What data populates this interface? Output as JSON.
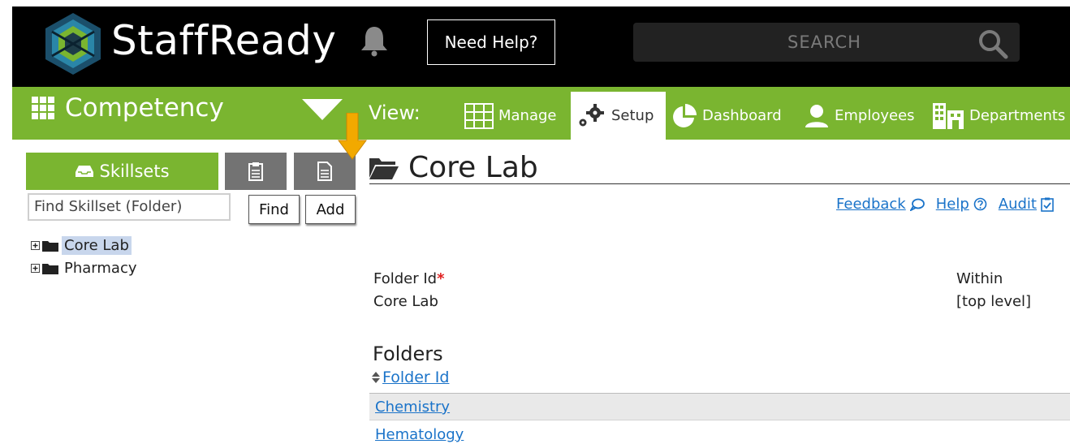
{
  "header": {
    "brand": "StaffReady",
    "help_label": "Need Help?",
    "search_placeholder": "SEARCH"
  },
  "nav": {
    "module": "Competency",
    "view_label": "View:",
    "tabs": [
      {
        "label": "Manage",
        "icon": "grid-table-icon",
        "active": false
      },
      {
        "label": "Setup",
        "icon": "gears-icon",
        "active": true
      },
      {
        "label": "Dashboard",
        "icon": "pie-chart-icon",
        "active": false
      },
      {
        "label": "Employees",
        "icon": "person-icon",
        "active": false
      },
      {
        "label": "Departments",
        "icon": "building-icon",
        "active": false
      }
    ]
  },
  "sidebar": {
    "skillsets_tab": "Skillsets",
    "find_value": "Find Skillset (Folder)",
    "find_label": "Find",
    "add_label": "Add",
    "tree": [
      {
        "label": "Core Lab",
        "selected": true
      },
      {
        "label": "Pharmacy",
        "selected": false
      }
    ]
  },
  "main": {
    "title": "Core Lab",
    "links": {
      "feedback": "Feedback",
      "help": "Help",
      "audit": "Audit"
    },
    "folder_id_label": "Folder Id",
    "required_mark": "*",
    "folder_id_value": "Core Lab",
    "within_label": "Within",
    "within_value": "[top level]",
    "folders_heading": "Folders",
    "sort_col": "Folder Id",
    "rows": [
      "Chemistry",
      "Hematology"
    ]
  },
  "colors": {
    "accent_green": "#7ab530",
    "link_blue": "#1a73c9",
    "indicator_orange": "#f2a900"
  }
}
